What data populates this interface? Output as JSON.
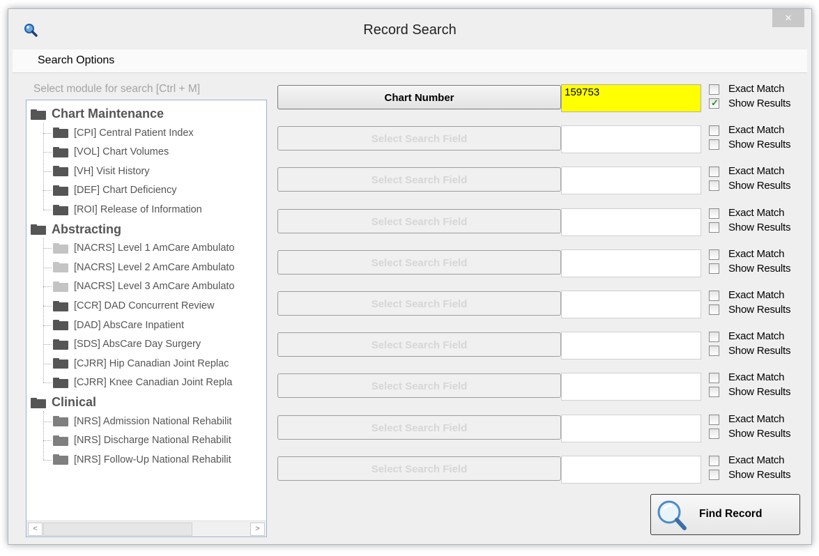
{
  "window": {
    "title": "Record Search",
    "close_glyph": "×"
  },
  "menu": {
    "search_options": "Search Options"
  },
  "module_select": {
    "label": "Select module for search [Ctrl + M]",
    "groups": [
      {
        "name": "Chart Maintenance",
        "items": [
          "[CPI] Central Patient Index",
          "[VOL] Chart Volumes",
          "[VH] Visit History",
          "[DEF] Chart Deficiency",
          "[ROI] Release of Information"
        ]
      },
      {
        "name": "Abstracting",
        "items": [
          "[NACRS] Level 1 AmCare Ambulato",
          "[NACRS] Level 2 AmCare Ambulato",
          "[NACRS] Level 3 AmCare Ambulato",
          "[CCR] DAD Concurrent Review",
          "[DAD] AbsCare Inpatient",
          "[SDS] AbsCare Day Surgery",
          "[CJRR] Hip Canadian Joint Replac",
          "[CJRR] Knee Canadian Joint Repla"
        ]
      },
      {
        "name": "Clinical",
        "items": [
          "[NRS] Admission National Rehabilit",
          "[NRS] Discharge National Rehabilit",
          "[NRS] Follow-Up National Rehabilit"
        ]
      }
    ],
    "scroll_left": "<",
    "scroll_right": ">"
  },
  "search_rows": [
    {
      "field": "Chart Number",
      "value": "159753",
      "exact_match": false,
      "show_results": true
    },
    {
      "field": "Select Search Field",
      "value": "",
      "exact_match": false,
      "show_results": false
    },
    {
      "field": "Select Search Field",
      "value": "",
      "exact_match": false,
      "show_results": false
    },
    {
      "field": "Select Search Field",
      "value": "",
      "exact_match": false,
      "show_results": false
    },
    {
      "field": "Select Search Field",
      "value": "",
      "exact_match": false,
      "show_results": false
    },
    {
      "field": "Select Search Field",
      "value": "",
      "exact_match": false,
      "show_results": false
    },
    {
      "field": "Select Search Field",
      "value": "",
      "exact_match": false,
      "show_results": false
    },
    {
      "field": "Select Search Field",
      "value": "",
      "exact_match": false,
      "show_results": false
    },
    {
      "field": "Select Search Field",
      "value": "",
      "exact_match": false,
      "show_results": false
    },
    {
      "field": "Select Search Field",
      "value": "",
      "exact_match": false,
      "show_results": false
    }
  ],
  "labels": {
    "exact_match": "Exact Match",
    "show_results": "Show Results"
  },
  "find_button": {
    "label": "Find Record",
    "icon": "magnifier-icon"
  },
  "colors": {
    "highlight": "#ffff00",
    "check": "#2a8d2a",
    "tree_border": "#9cb3cf"
  }
}
